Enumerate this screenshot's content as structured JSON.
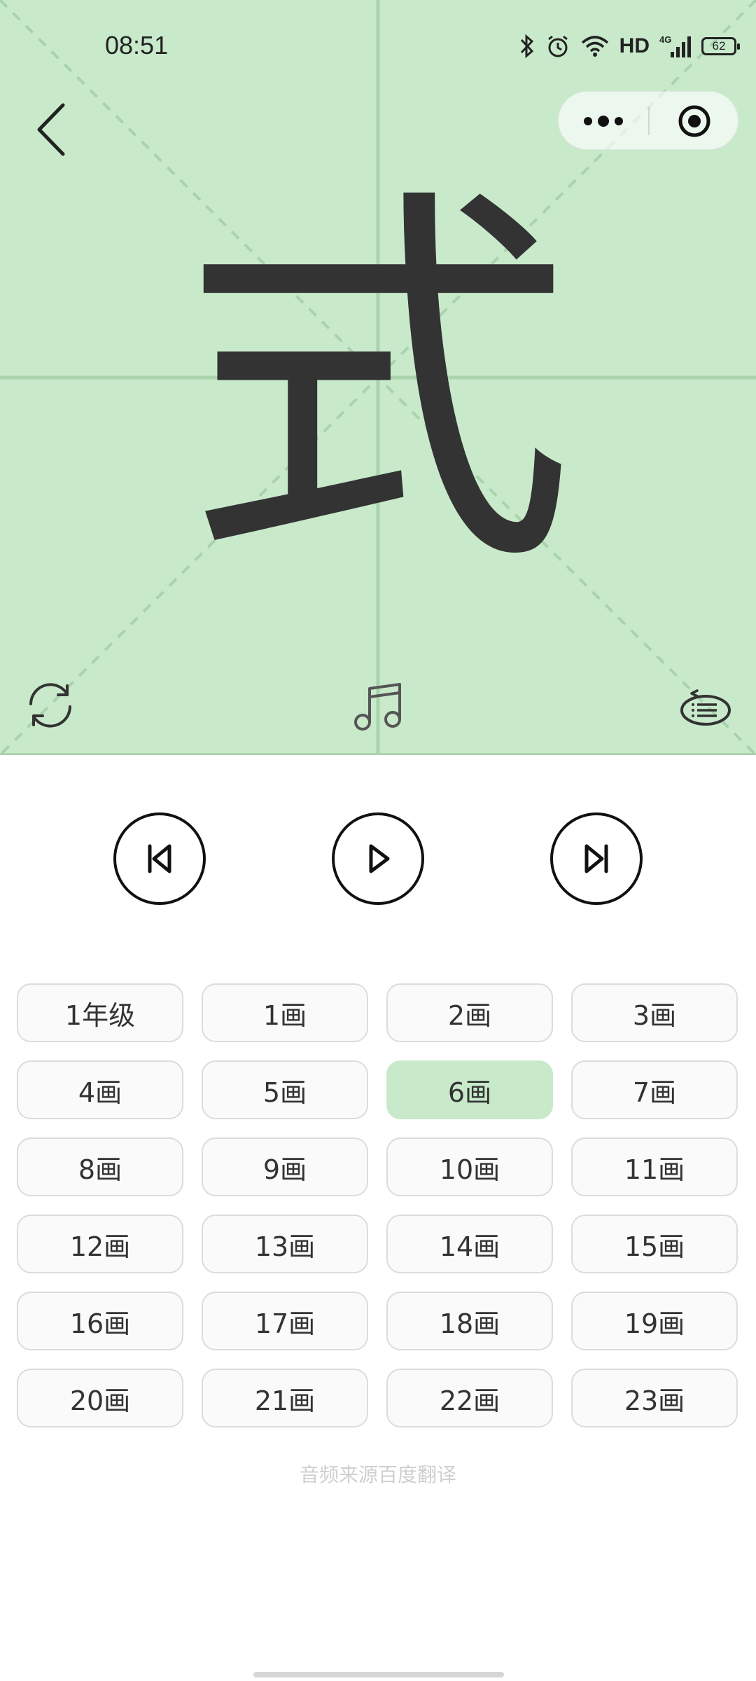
{
  "status_bar": {
    "time": "08:51",
    "network_label": "HD",
    "signal_label": "4G",
    "battery_level": "62",
    "icons": [
      "bluetooth-icon",
      "alarm-icon",
      "wifi-icon",
      "signal-icon",
      "battery-icon"
    ]
  },
  "board": {
    "character": "式",
    "background_color": "#c8eacb",
    "grid_color": "#a9d3ad",
    "character_color": "#333333"
  },
  "header": {
    "back_icon": "chevron-left-icon",
    "more_icon": "more-dots-icon",
    "close_icon": "target-icon"
  },
  "tools": {
    "refresh_icon": "refresh-icon",
    "music_icon": "music-note-icon",
    "list_icon": "list-icon"
  },
  "controls": {
    "prev_icon": "skip-previous-icon",
    "play_icon": "play-icon",
    "next_icon": "skip-next-icon"
  },
  "chips": [
    "1年级",
    "1画",
    "2画",
    "3画",
    "4画",
    "5画",
    "6画",
    "7画",
    "8画",
    "9画",
    "10画",
    "11画",
    "12画",
    "13画",
    "14画",
    "15画",
    "16画",
    "17画",
    "18画",
    "19画",
    "20画",
    "21画",
    "22画",
    "23画"
  ],
  "selected_chip": "6画",
  "footer_note": "音频来源百度翻译"
}
